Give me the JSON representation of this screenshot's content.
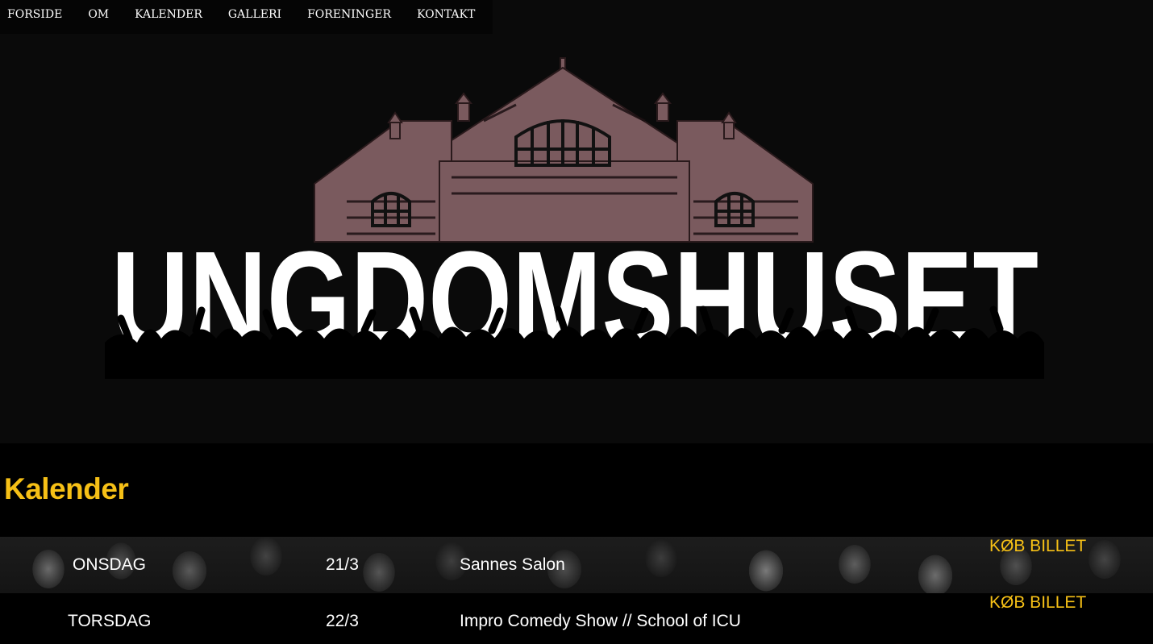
{
  "nav": {
    "items": [
      "FORSIDE",
      "OM",
      "KALENDER",
      "GALLERI",
      "FORENINGER",
      "KONTAKT"
    ]
  },
  "logo": {
    "text": "UNGDOMSHUSET",
    "colors": {
      "building": "#7a5a5e",
      "lettering": "#ffffff",
      "background": "#0a0a0a"
    }
  },
  "calendar": {
    "title": "Kalender",
    "accent_color": "#f6c016",
    "events": [
      {
        "day": "ONSDAG",
        "date": "21/3",
        "title": "Sannes Salon",
        "ticket": "KØB BILLET"
      },
      {
        "day": "TORSDAG",
        "date": "22/3",
        "title": "Impro Comedy Show // School of ICU",
        "ticket": "KØB BILLET"
      }
    ]
  }
}
